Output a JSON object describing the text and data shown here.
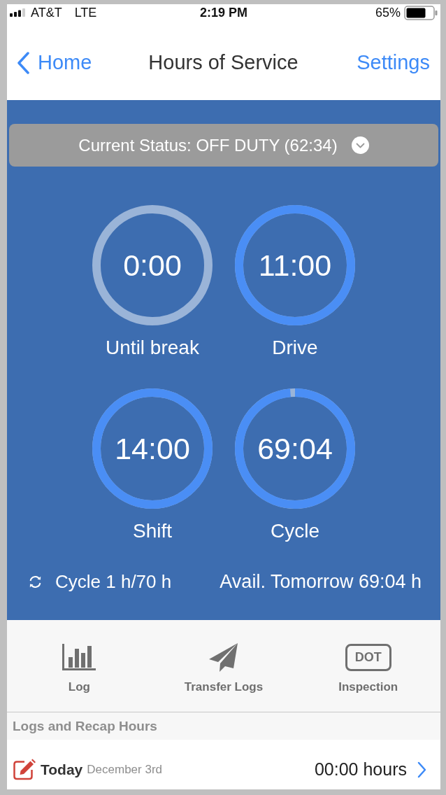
{
  "status_bar": {
    "carrier": "AT&T",
    "network": "LTE",
    "time": "2:19 PM",
    "battery": "65%"
  },
  "nav_bar": {
    "back": "Home",
    "title": "Hours of Service",
    "action": "Settings"
  },
  "current_status": {
    "label": "Current Status: OFF DUTY (62:34)"
  },
  "timers": [
    {
      "value": "0:00",
      "label": "Until break"
    },
    {
      "value": "11:00",
      "label": "Drive",
      "level": 1
    },
    {
      "value": "14:00",
      "label": "Shift",
      "level": 1
    },
    {
      "value": "69:04",
      "label": "Cycle",
      "level": 0.987
    }
  ],
  "summary": {
    "cycle": "Cycle 1 h/70 h",
    "available": "Avail. Tomorrow 69:04 h"
  },
  "toolbar": [
    {
      "kind": "chart",
      "label": "Log"
    },
    {
      "kind": "send",
      "label": "Transfer Logs"
    },
    {
      "kind": "badge",
      "badge": "DOT",
      "label": "Inspection"
    }
  ],
  "section": {
    "title": "Logs and Recap Hours",
    "rows": [
      {
        "title": "Today",
        "date": "December 3rd",
        "hours": "00:00 hours"
      }
    ]
  }
}
